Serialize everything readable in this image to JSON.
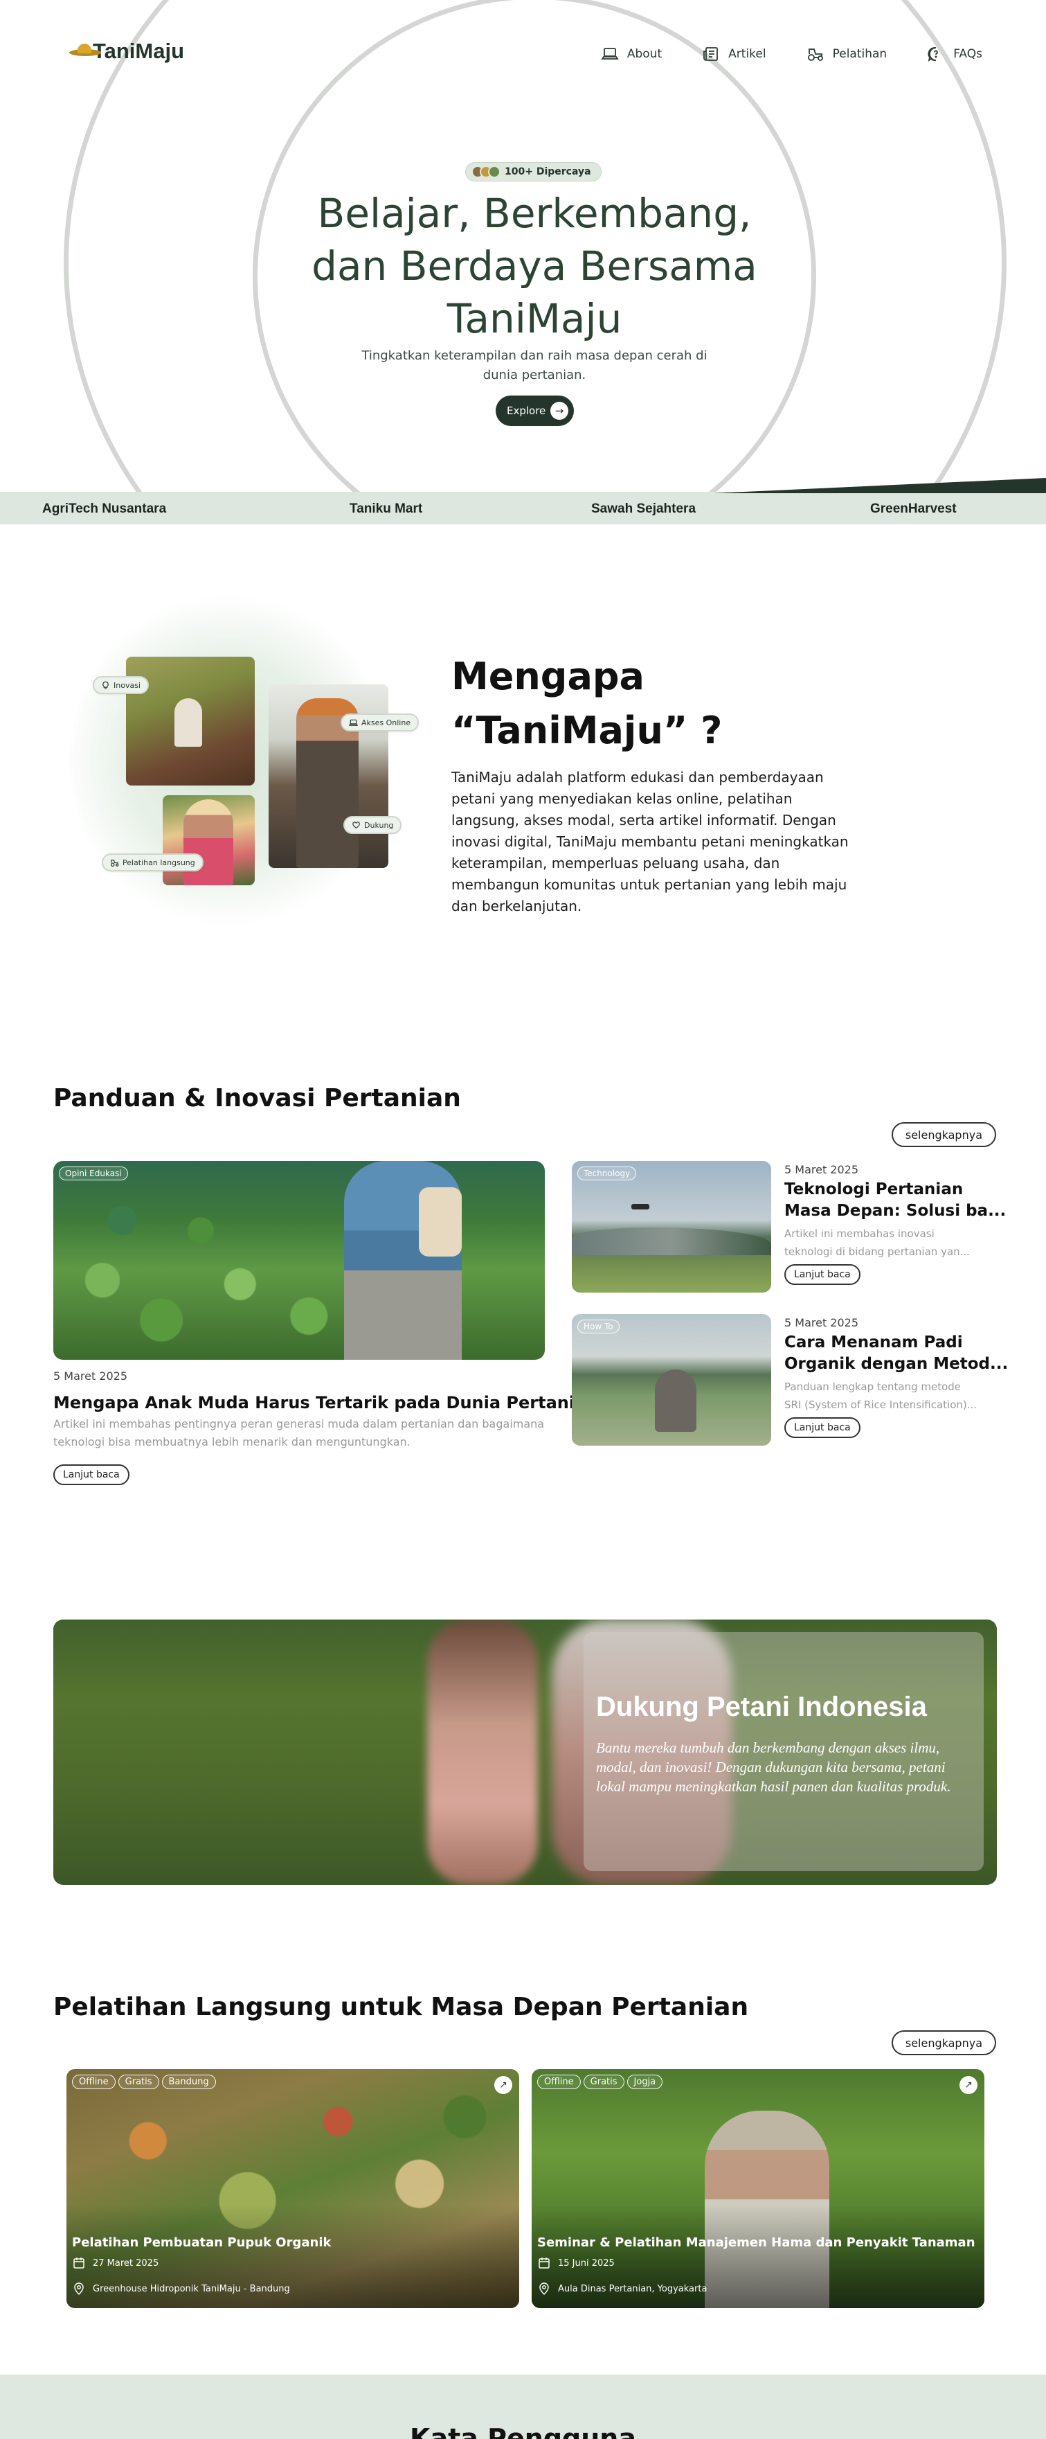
{
  "brand": {
    "name": "TaniMaju"
  },
  "nav": [
    {
      "label": "About",
      "icon": "laptop-icon"
    },
    {
      "label": "Artikel",
      "icon": "newspaper-icon"
    },
    {
      "label": "Pelatihan",
      "icon": "tractor-icon"
    },
    {
      "label": "FAQs",
      "icon": "chat-question-icon"
    }
  ],
  "hero": {
    "badge": "100+ Dipercaya",
    "title": "Belajar, Berkembang, dan Berdaya Bersama TaniMaju",
    "subtitle": "Tingkatkan keterampilan dan raih masa depan cerah di dunia pertanian.",
    "cta": "Explore"
  },
  "partners": [
    "AgriTech Nusantara",
    "Taniku Mart",
    "Sawah Sejahtera",
    "GreenHarvest"
  ],
  "why": {
    "title_line1": "Mengapa",
    "title_line2": "“TaniMaju” ?",
    "text": "TaniMaju adalah platform edukasi dan pemberdayaan petani yang menyediakan kelas online, pelatihan langsung, akses modal, serta artikel informatif. Dengan inovasi digital, TaniMaju membantu petani meningkatkan keterampilan, memperluas peluang usaha, dan membangun komunitas untuk pertanian yang lebih maju dan berkelanjutan.",
    "chips": {
      "inovasi": "Inovasi",
      "akses": "Akses Online",
      "dukung": "Dukung",
      "pelatihan": "Pelatihan langsung"
    }
  },
  "articles": {
    "title": "Panduan & Inovasi Pertanian",
    "more": "selengkapnya",
    "read_label": "Lanjut baca",
    "featured": {
      "tag": "Opini Edukasi",
      "date": "5 Maret 2025",
      "title": "Mengapa Anak Muda Harus Tertarik pada Dunia Pertanian?",
      "desc": "Artikel ini membahas pentingnya peran generasi muda dalam pertanian dan bagaimana teknologi bisa membuatnya lebih menarik dan menguntungkan."
    },
    "side": [
      {
        "tag": "Technology",
        "date": "5 Maret 2025",
        "title_line1": "Teknologi Pertanian",
        "title_line2": "Masa Depan: Solusi ba...",
        "desc_line1": "Artikel ini membahas inovasi",
        "desc_line2": "teknologi di bidang pertanian yan..."
      },
      {
        "tag": "How To",
        "date": "5 Maret 2025",
        "title_line1": "Cara Menanam Padi",
        "title_line2": "Organik dengan Metod...",
        "desc_line1": "Panduan lengkap tentang metode",
        "desc_line2": "SRI (System of Rice Intensification)..."
      }
    ]
  },
  "support": {
    "title": "Dukung Petani Indonesia",
    "text": "Bantu mereka tumbuh dan berkembang dengan akses ilmu, modal, dan inovasi! Dengan dukungan kita bersama, petani lokal mampu meningkatkan hasil panen dan kualitas produk."
  },
  "trainings": {
    "title": "Pelatihan Langsung untuk Masa Depan Pertanian",
    "more": "selengkapnya",
    "items": [
      {
        "tags": [
          "Offline",
          "Gratis",
          "Bandung"
        ],
        "title": "Pelatihan Pembuatan Pupuk Organik",
        "date": "27 Maret 2025",
        "location": "Greenhouse Hidroponik TaniMaju - Bandung"
      },
      {
        "tags": [
          "Offline",
          "Gratis",
          "Jogja"
        ],
        "title": "Seminar & Pelatihan Manajemen Hama dan Penyakit Tanaman",
        "date": "15 Juni 2025",
        "location": "Aula Dinas Pertanian, Yogyakarta"
      }
    ]
  },
  "bottom": {
    "title": "Kata Pengguna"
  },
  "colors": {
    "primary": "#24352c",
    "hero_title": "#2c4433",
    "band": "#dde7df",
    "ring": "#d3d6d3"
  }
}
